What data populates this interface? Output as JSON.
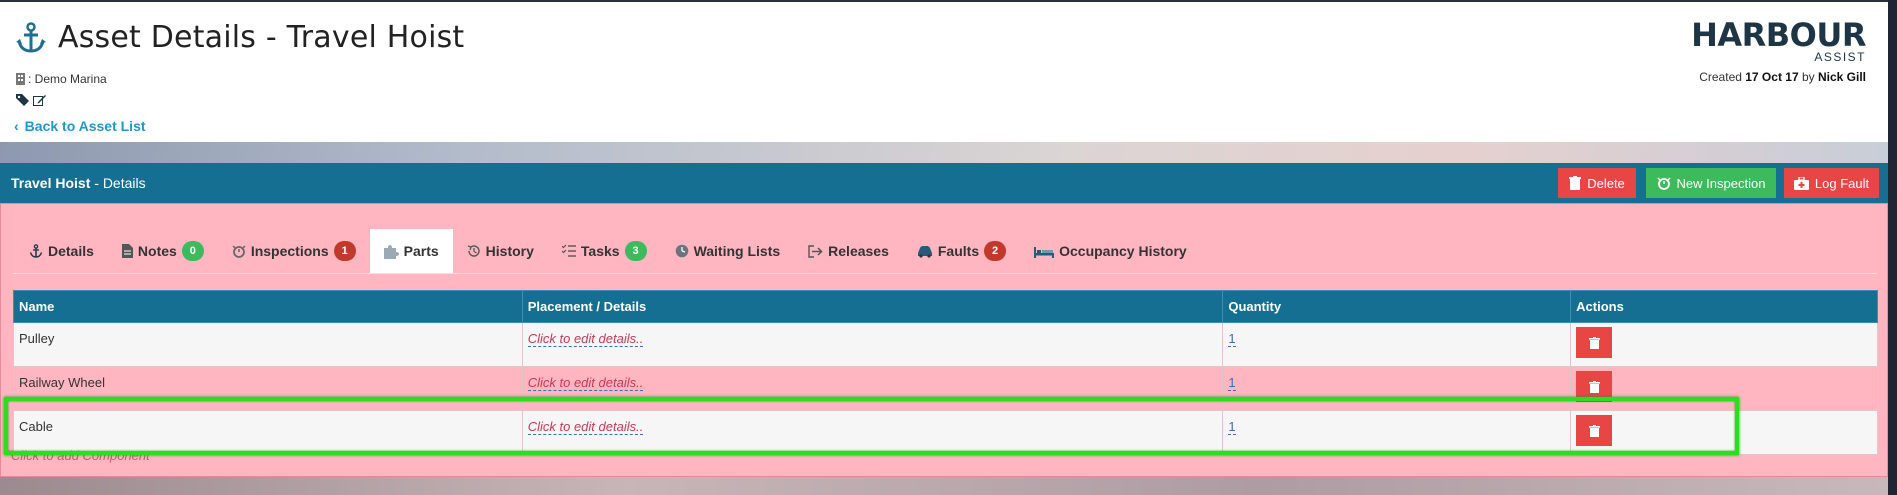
{
  "header": {
    "title": "Asset Details - Travel Hoist",
    "marina": ": Demo Marina",
    "back_link": "Back to Asset List",
    "logo_main": "HARBOUR",
    "logo_sub": "ASSIST",
    "created_prefix": "Created ",
    "created_date": "17 Oct 17",
    "created_by_prefix": " by ",
    "created_by": "Nick Gill"
  },
  "panel": {
    "asset_name": "Travel Hoist",
    "section": " - Details",
    "buttons": {
      "delete": "Delete",
      "new_inspection": "New Inspection",
      "log_fault": "Log Fault"
    }
  },
  "tabs": [
    {
      "label": "Details",
      "icon": "anchor-icon"
    },
    {
      "label": "Notes",
      "badge": "0",
      "icon": "note-icon"
    },
    {
      "label": "Inspections",
      "badge": "1",
      "icon": "alarm-clock-icon"
    },
    {
      "label": "Parts",
      "icon": "puzzle-icon",
      "active": true
    },
    {
      "label": "History",
      "icon": "history-icon"
    },
    {
      "label": "Tasks",
      "badge": "3",
      "icon": "tasks-icon"
    },
    {
      "label": "Waiting Lists",
      "icon": "clock-icon"
    },
    {
      "label": "Releases",
      "icon": "sign-out-icon"
    },
    {
      "label": "Faults",
      "badge": "2",
      "icon": "car-icon"
    },
    {
      "label": "Occupancy History",
      "icon": "bed-icon"
    }
  ],
  "table": {
    "headers": [
      "Name",
      "Placement / Details",
      "Quantity",
      "Actions"
    ],
    "rows": [
      {
        "name": "Pulley",
        "details": "Click to edit details..",
        "quantity": "1"
      },
      {
        "name": "Railway Wheel",
        "details": "Click to edit details..",
        "quantity": "1"
      },
      {
        "name": "Cable",
        "details": "Click to edit details..",
        "quantity": "1"
      }
    ]
  },
  "add_component": "Click to add Component",
  "colors": {
    "header_blue": "#156f93",
    "panel_pink": "#ffb6c1",
    "danger_red": "#e84545",
    "success_green": "#3dbb5c",
    "highlight_green": "#29e01e"
  }
}
